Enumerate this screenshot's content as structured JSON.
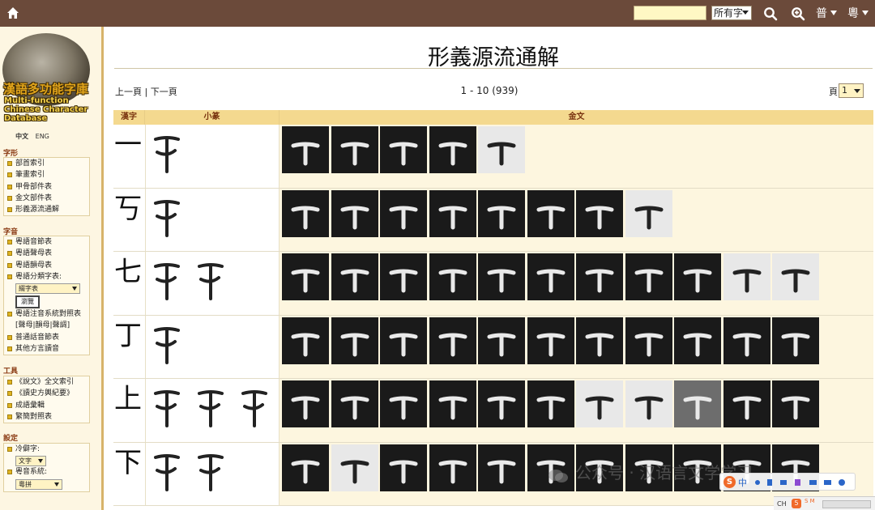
{
  "topbar": {
    "search_value": "",
    "scope_select": "所有字",
    "lang_putonghua": "普",
    "lang_cantonese": "粵",
    "bg_color": "#6b4a3a"
  },
  "sidebar": {
    "logo_cn": "漢語多功能字庫",
    "logo_en": "Multi-function Chinese Character Database",
    "lang_zh": "中文",
    "lang_en": "ENG",
    "sections": [
      {
        "title": "字形",
        "items": [
          "部首索引",
          "筆畫索引",
          "甲骨部件表",
          "金文部件表",
          "形義源流通解"
        ]
      },
      {
        "title": "字音",
        "items": [
          "粵語音節表",
          "粵語聲母表",
          "粵語韻母表",
          "粵語分類字表:",
          "粵語注音系統對照表",
          "[聲母|韻母|聲調]",
          "普通話音節表",
          "其他方言讀音"
        ],
        "select": "綴字表",
        "button": "瀏覽"
      },
      {
        "title": "工具",
        "items": [
          "《說文》全文索引",
          "《讀史方輿紀要》",
          "成語彙輯",
          "繁簡對照表"
        ]
      },
      {
        "title": "設定",
        "items": [
          "冷僻字:",
          "粵音系統:"
        ],
        "select_rare": "文字",
        "select_yue": "粵拼"
      }
    ]
  },
  "main": {
    "title": "形義源流通解",
    "prev": "上一頁",
    "next": "下一頁",
    "separator": "|",
    "range": "1 - 10 (939)",
    "page_label": "頁",
    "page_value": "1",
    "headers": [
      "漢字",
      "小篆",
      "金文"
    ],
    "rows": [
      {
        "char": "一",
        "seal": 1,
        "bronze": [
          "d",
          "d",
          "d",
          "d",
          "l"
        ]
      },
      {
        "char": "丂",
        "seal": 1,
        "bronze": [
          "d",
          "d",
          "d",
          "d",
          "d",
          "d",
          "d",
          "l"
        ]
      },
      {
        "char": "七",
        "seal": 2,
        "bronze": [
          "d",
          "d",
          "d",
          "d",
          "d",
          "d",
          "d",
          "d",
          "d",
          "l",
          "l"
        ]
      },
      {
        "char": "丁",
        "seal": 1,
        "bronze": [
          "d",
          "d",
          "d",
          "d",
          "d",
          "d",
          "d",
          "d",
          "d",
          "d",
          "d"
        ]
      },
      {
        "char": "上",
        "seal": 3,
        "bronze": [
          "d",
          "d",
          "d",
          "d",
          "d",
          "d",
          "l",
          "l",
          "m",
          "d",
          "d"
        ]
      },
      {
        "char": "下",
        "seal": 2,
        "bronze": [
          "d",
          "l",
          "d",
          "d",
          "d",
          "d",
          "d",
          "d",
          "d",
          "d",
          "d"
        ]
      }
    ]
  },
  "watermark": "公众号 · 汉语言文学学习",
  "ime": {
    "logo": "S",
    "mode": "中"
  },
  "tray": {
    "ch": "CH",
    "s": "5",
    "m": "S M"
  }
}
